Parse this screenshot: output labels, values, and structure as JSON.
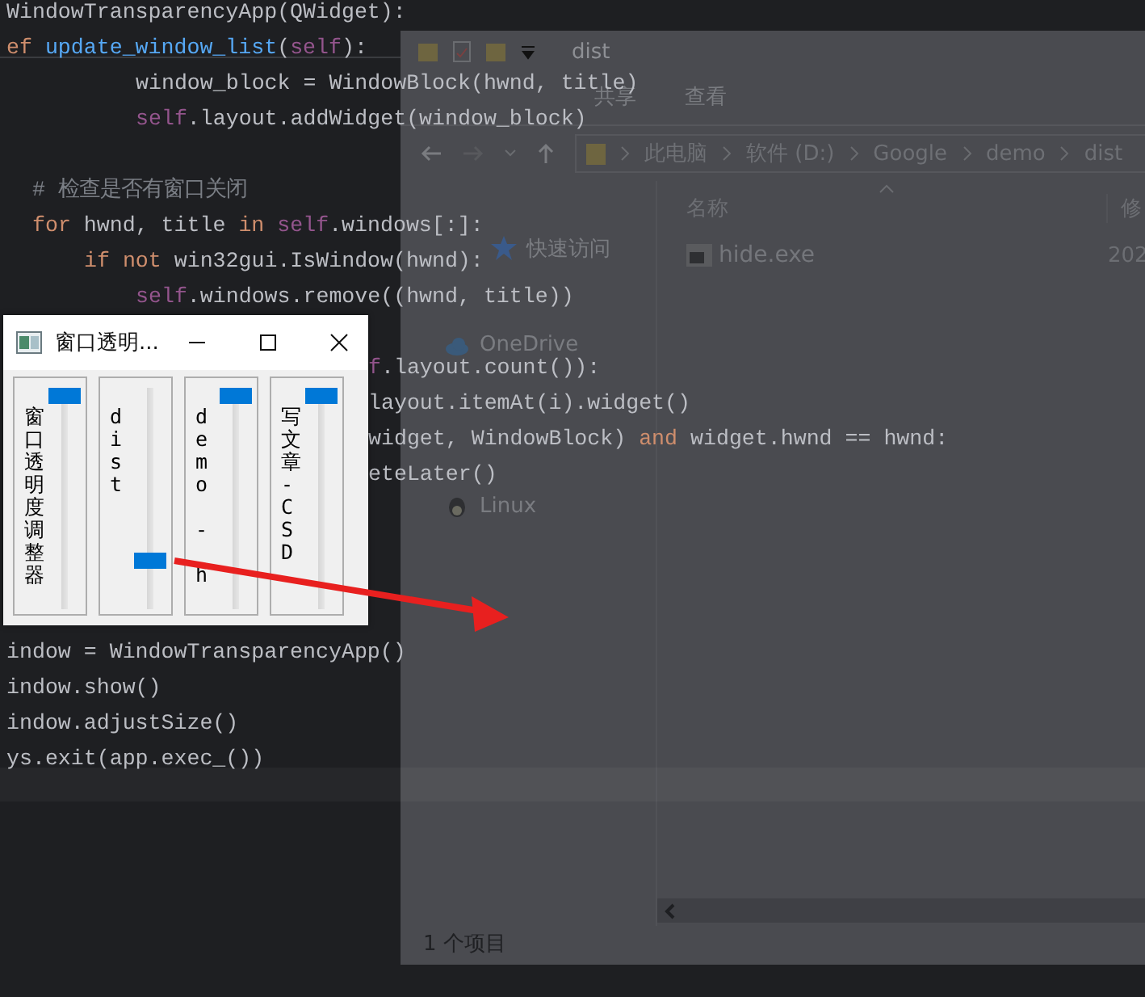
{
  "editor": {
    "lines": [
      {
        "kind": "top",
        "segments": [
          {
            "kind": "plain",
            "text": "WindowTransparencyApp(QWidget):"
          }
        ]
      },
      {
        "kind": "top",
        "segments": [
          {
            "kind": "keyword",
            "text": "ef "
          },
          {
            "kind": "func",
            "text": "update_window_list"
          },
          {
            "kind": "plain",
            "text": "("
          },
          {
            "kind": "self",
            "text": "self"
          },
          {
            "kind": "plain",
            "text": "):"
          }
        ]
      },
      {
        "kind": "deep",
        "segments": [
          {
            "kind": "plain",
            "text": "window_block = WindowBlock(hwnd, title)"
          }
        ]
      },
      {
        "kind": "deep",
        "segments": [
          {
            "kind": "self",
            "text": "self"
          },
          {
            "kind": "plain",
            "text": ".layout.addWidget(window_block)"
          }
        ]
      },
      {
        "kind": "blank"
      },
      {
        "kind": "block",
        "segments": [
          {
            "kind": "comment",
            "text": "# 检查是否有窗口关闭"
          }
        ]
      },
      {
        "kind": "block",
        "segments": [
          {
            "kind": "keyword",
            "text": "for"
          },
          {
            "kind": "plain",
            "text": " hwnd, title "
          },
          {
            "kind": "keyword",
            "text": "in "
          },
          {
            "kind": "self",
            "text": "self"
          },
          {
            "kind": "plain",
            "text": ".windows[:]:"
          }
        ]
      },
      {
        "kind": "nested",
        "segments": [
          {
            "kind": "keyword",
            "text": "if not"
          },
          {
            "kind": "plain",
            "text": " win32gui.IsWindow(hwnd):"
          }
        ]
      },
      {
        "kind": "deep",
        "segments": [
          {
            "kind": "self",
            "text": "self"
          },
          {
            "kind": "plain",
            "text": ".windows.remove((hwnd, title))"
          }
        ]
      },
      {
        "kind": "blank"
      },
      {
        "kind": "right",
        "segments": [
          {
            "kind": "self",
            "text": "f"
          },
          {
            "kind": "plain",
            "text": ".layout.count()):"
          }
        ]
      },
      {
        "kind": "right",
        "segments": [
          {
            "kind": "plain",
            "text": "layout.itemAt(i).widget()"
          }
        ]
      },
      {
        "kind": "right",
        "segments": [
          {
            "kind": "plain",
            "text": "widget, WindowBlock) "
          },
          {
            "kind": "keyword",
            "text": "and"
          },
          {
            "kind": "plain",
            "text": " widget.hwnd == hwnd:"
          }
        ]
      },
      {
        "kind": "right",
        "segments": [
          {
            "kind": "plain",
            "text": "eteLater()"
          }
        ]
      },
      {
        "kind": "blank"
      },
      {
        "kind": "blank"
      },
      {
        "kind": "blank"
      },
      {
        "kind": "blank"
      },
      {
        "kind": "top",
        "segments": [
          {
            "kind": "plain",
            "text": "indow = WindowTransparencyApp()"
          }
        ]
      },
      {
        "kind": "top",
        "segments": [
          {
            "kind": "plain",
            "text": "indow.show()"
          }
        ]
      },
      {
        "kind": "top",
        "segments": [
          {
            "kind": "plain",
            "text": "indow.adjustSize()"
          }
        ]
      },
      {
        "kind": "top",
        "segments": [
          {
            "kind": "plain",
            "text": "ys.exit(app.exec_())"
          }
        ]
      }
    ]
  },
  "explorer": {
    "title": "dist",
    "ribbon_tabs": [
      "共享",
      "查看"
    ],
    "address": [
      "此电脑",
      "软件 (D:)",
      "Google",
      "demo",
      "dist"
    ],
    "columns": [
      "名称",
      "修"
    ],
    "files": [
      {
        "name": "hide.exe",
        "modified": "202"
      }
    ],
    "nav_items": [
      {
        "label": "快速访问",
        "kind": "quick_access"
      },
      {
        "label": "OneDrive",
        "kind": "cloud"
      },
      {
        "label": "Linux",
        "kind": "linux"
      }
    ],
    "status": "1 个项目"
  },
  "transparency_window": {
    "title": "窗口透明...",
    "blocks": [
      {
        "label": "窗口透明度调整器",
        "level": 1
      },
      {
        "label": "dist",
        "level": 0.2
      },
      {
        "label": "demo - h",
        "level": 1
      },
      {
        "label": "写文章-CSD",
        "level": 1
      }
    ]
  }
}
